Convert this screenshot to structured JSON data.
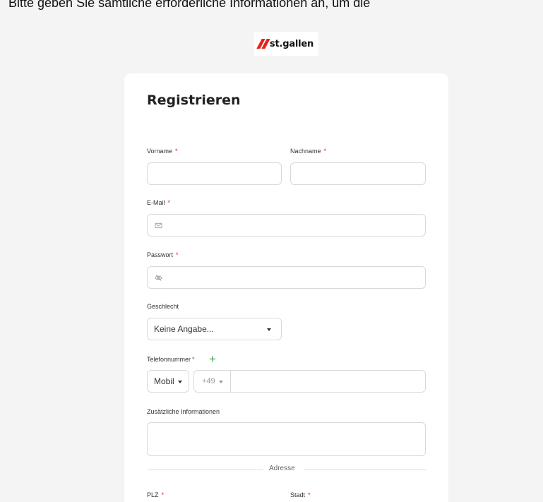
{
  "top_text": "Bitte geben Sie sämtliche erforderliche Informationen an, um die",
  "logo": {
    "text": "st.gallen",
    "accent": "#e2231a"
  },
  "form": {
    "title": "Registrieren",
    "required_mark": "*",
    "first_name_label": "Vorname",
    "last_name_label": "Nachname",
    "email_label": "E-Mail",
    "password_label": "Passwort",
    "gender_label": "Geschlecht",
    "gender_value": "Keine Angabe...",
    "phone_label": "Telefonnummer",
    "phone_add": "+",
    "phone_type": "Mobil",
    "phone_prefix": "+49",
    "additional_label": "Zusätzliche Informationen",
    "address_divider": "Adresse",
    "zip_label": "PLZ",
    "city_label": "Stadt"
  },
  "colors": {
    "required": "#e2231a",
    "add": "#35a34a",
    "background": "#f4f4f4"
  },
  "icons": {
    "email": "envelope-icon",
    "password": "eye-off-icon",
    "dropdown": "caret-down-icon",
    "add": "plus-icon"
  }
}
